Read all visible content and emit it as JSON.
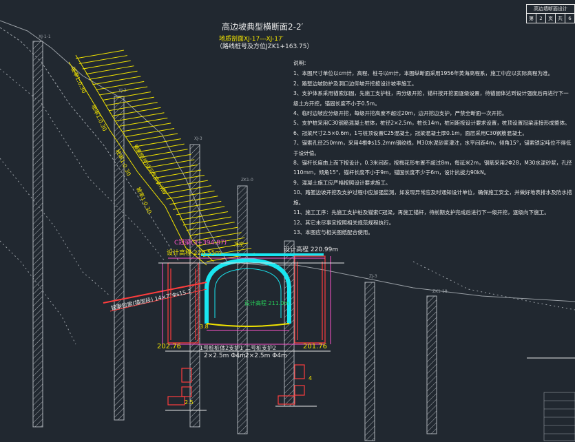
{
  "title_block": {
    "header": "高边墙断面设计",
    "sheet_label": "第",
    "sheet_no": "2",
    "page_unit": "页",
    "total_label": "共",
    "total_no": "6"
  },
  "drawing_title": {
    "main": "高边坡典型横断面2-2′",
    "sub": "地质剖面XJ-17---XJ-17′",
    "station": "（路线桩号及方位JZK1+163.75）"
  },
  "notes": {
    "heading": "说明：",
    "items": [
      "1、本图尺寸单位以cm计，高程、桩号以m计，本图纵断面采用1956年黄海高程系，施工中应以实际高程为准。",
      "2、路堑边坡防护及洞口边仰坡开挖按设计坡率施工。",
      "3、支护体系采用锚索加固，先施工支护桩，再分级开挖，锚杆按开挖面逐级设置，待锚固体达到设计强度后再进行下一级土方开挖，锚固长度不小于0.5m。",
      "4、临时边坡应分级开挖，每级开挖高度不超过20m，边开挖边支护，严禁全断面一次开挖。",
      "5、支护桩采用C30钢筋混凝土桩体，桩径2×2.5m，桩长14m，桩间距按设计要求设置，桩顶设置冠梁连接形成整体。",
      "6、冠梁尺寸2.5×0.6m，1号桩顶设置C25混凝土，冠梁混凝土厚0.1m，面层采用C30钢筋混凝土。",
      "7、锚索孔径250mm，采用4根Φs15.2mm钢绞线，M30水泥砂浆灌注，水平间距4m，倾角15°，锚索锁定吨位不得低于设计值。",
      "8、锚杆长度由上而下按设计，0.3米间距，按梅花形布置不超过8m，每延米2m，钢筋采用2Φ28，M30水泥砂浆，孔径110mm，倾角15°，锚杆长度不小于9m，锚固长度不少于6m，设计抗拔力90kN。",
      "9、混凝土施工应严格按照设计要求施工。",
      "10、路堑边坡开挖及支护过程中应加强监测，如发现异常应及时通知设计单位，确保施工安全，并做好地表排水及防水措施。",
      "11、施工工序：先施工支护桩及锚索C冠梁，再施工锚杆，待前期支护完成后进行下一级开挖，逐级向下施工。",
      "12、其它未尽事宜按照相关规范规程执行。",
      "13、本图应与相关图纸配合使用。"
    ]
  },
  "annotations": {
    "slope_grades": [
      "坡率1:0.30",
      "坡率1:0.30",
      "坡率1:0.30",
      "坡率1:0.30"
    ],
    "anchor_label": "锚索桩(排)详见专项设计图",
    "beam_label": "C冠梁(3+394.87)",
    "design_elev_left": "设计高程 220.55m",
    "design_elev_right": "设计高程 220.99m",
    "tunnel_elev": "设计高程 211.0m",
    "tunnel_clearance": "净空",
    "cable_left": "锚索拉索(锚固段) 14×7°Φs15.2",
    "pile_label_left": "1号桩桩体2支护1",
    "pile_label_right": "二号桩支护2",
    "pile_dim_left": "2×2.5m Φ4m",
    "pile_dim_right": "2×2.5m Φ4m",
    "elev_left": "202.76",
    "elev_right": "201.76",
    "dim_2_5": "2.5",
    "dim_3_8": "3.8",
    "dim_4": "4",
    "ground_labels": [
      "XJ-1-1",
      "XJ-2",
      "XJ-3",
      "ZK1-0",
      "ZJ-3",
      "ZK1-18"
    ]
  },
  "colors": {
    "background": "#212830",
    "yellow": "#f2e400",
    "cyan": "#19e6f0",
    "red": "#ff3d3d",
    "magenta": "#ff55cc",
    "green": "#27d65a",
    "white": "#e8e8e8",
    "grey": "#9aa0a6"
  }
}
